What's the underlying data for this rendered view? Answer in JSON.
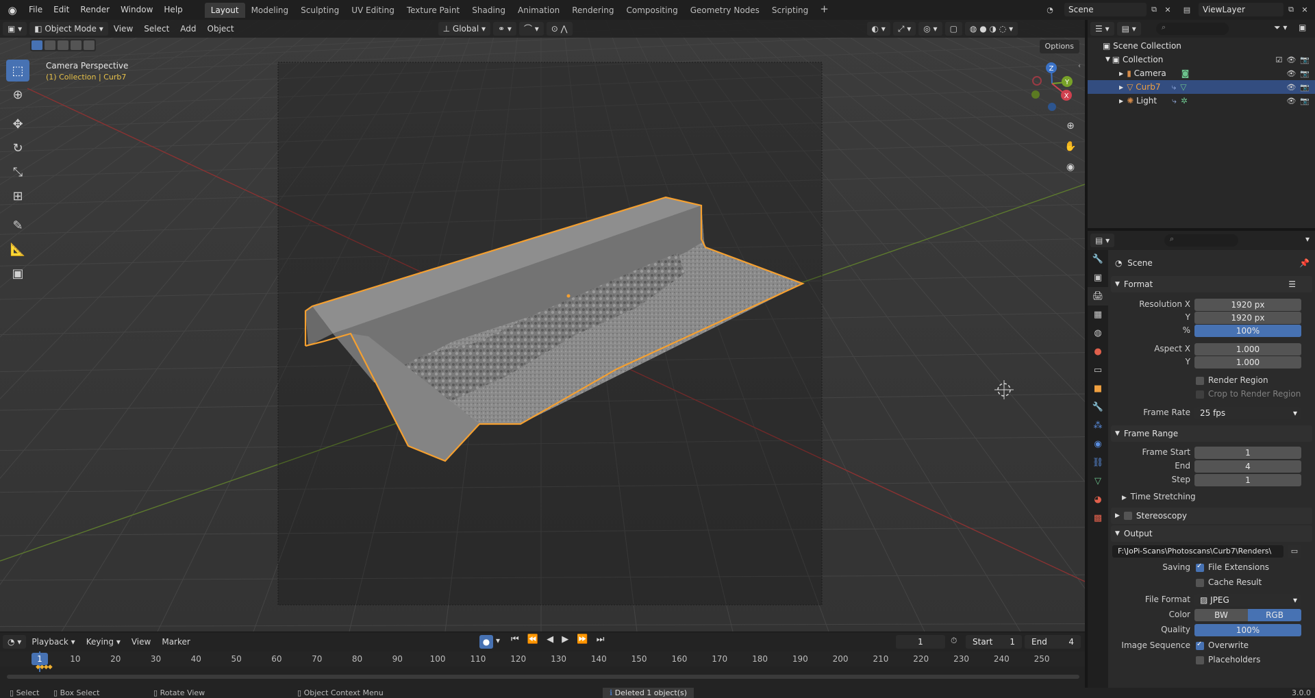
{
  "topbar": {
    "menus": [
      "File",
      "Edit",
      "Render",
      "Window",
      "Help"
    ],
    "workspaces": [
      "Layout",
      "Modeling",
      "Sculpting",
      "UV Editing",
      "Texture Paint",
      "Shading",
      "Animation",
      "Rendering",
      "Compositing",
      "Geometry Nodes",
      "Scripting"
    ],
    "active_workspace": "Layout",
    "scene_name": "Scene",
    "view_layer": "ViewLayer"
  },
  "viewport": {
    "mode": "Object Mode",
    "menus": [
      "View",
      "Select",
      "Add",
      "Object"
    ],
    "orientation": "Global",
    "options_label": "Options",
    "camera_label": "Camera Perspective",
    "collection_label": "(1) Collection | Curb7",
    "gizmo_axes": [
      "Z",
      "Y",
      "X"
    ],
    "selection_color": "#f5a030"
  },
  "outliner": {
    "root": "Scene Collection",
    "collection": "Collection",
    "objects": [
      {
        "name": "Camera",
        "selected": false
      },
      {
        "name": "Curb7",
        "selected": true
      },
      {
        "name": "Light",
        "selected": false
      }
    ]
  },
  "properties": {
    "context": "Scene",
    "format": {
      "title": "Format",
      "resolution_x_label": "Resolution X",
      "resolution_x": "1920 px",
      "y_label": "Y",
      "resolution_y": "1920 px",
      "percent_label": "%",
      "percent": "100%",
      "aspect_x_label": "Aspect X",
      "aspect_x": "1.000",
      "aspect_y": "1.000",
      "render_region": "Render Region",
      "crop_region": "Crop to Render Region",
      "frame_rate_label": "Frame Rate",
      "frame_rate": "25 fps"
    },
    "frame_range": {
      "title": "Frame Range",
      "start_label": "Frame Start",
      "start": "1",
      "end_label": "End",
      "end": "4",
      "step_label": "Step",
      "step": "1",
      "time_stretching": "Time Stretching"
    },
    "stereoscopy": "Stereoscopy",
    "output": {
      "title": "Output",
      "path": "F:\\JoPi-Scans\\Photoscans\\Curb7\\Renders\\",
      "saving_label": "Saving",
      "file_extensions": "File Extensions",
      "cache_result": "Cache Result",
      "file_format_label": "File Format",
      "file_format": "JPEG",
      "color_label": "Color",
      "color_bw": "BW",
      "color_rgb": "RGB",
      "quality_label": "Quality",
      "quality": "100%",
      "image_sequence_label": "Image Sequence",
      "overwrite": "Overwrite",
      "placeholders": "Placeholders"
    }
  },
  "timeline": {
    "menus": [
      "Playback",
      "Keying",
      "View",
      "Marker"
    ],
    "current_frame": "1",
    "start_label": "Start",
    "start": "1",
    "end_label": "End",
    "end": "4",
    "ticks": [
      "1",
      "10",
      "20",
      "30",
      "40",
      "50",
      "60",
      "70",
      "80",
      "90",
      "100",
      "110",
      "120",
      "130",
      "140",
      "150",
      "160",
      "170",
      "180",
      "190",
      "200",
      "210",
      "220",
      "230",
      "240",
      "250"
    ]
  },
  "statusbar": {
    "select": "Select",
    "box_select": "Box Select",
    "rotate_view": "Rotate View",
    "context_menu": "Object Context Menu",
    "message": "Deleted 1 object(s)",
    "version": "3.0.0"
  }
}
